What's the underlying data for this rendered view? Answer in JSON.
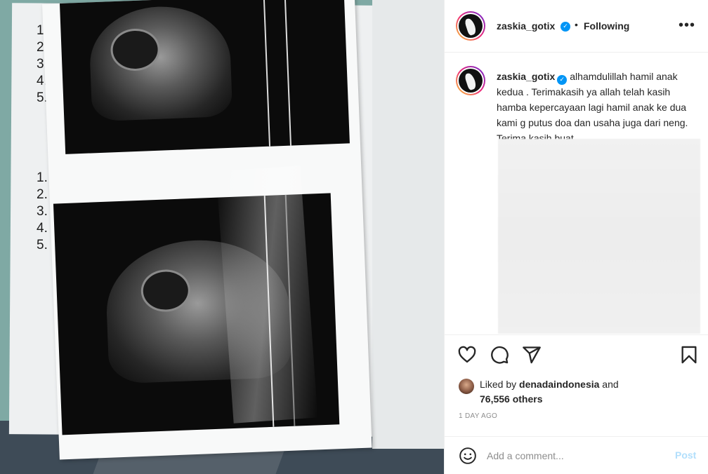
{
  "post": {
    "username": "zaskia_gotix",
    "verified_mark": "✓",
    "separator": "•",
    "follow_status": "Following",
    "more_label": "•••"
  },
  "caption": {
    "username": "zaskia_gotix",
    "text": "alhamdulillah hamil anak kedua . Terimakasih ya allah telah kasih hamba kepercayaan lagi hamil anak ke dua kami g putus doa dan usaha juga dari neng. Terima kasih buat"
  },
  "likes": {
    "prefix": "Liked by",
    "liker": "denadaindonesia",
    "conjunction": "and",
    "others": "76,556 others"
  },
  "timestamp": "1 day ago",
  "comment_box": {
    "placeholder": "Add a comment...",
    "post_label": "Post"
  },
  "photo": {
    "list_top": [
      "1.",
      "2.",
      "3.",
      "4.",
      "5."
    ],
    "list_bottom": [
      "1.",
      "2.",
      "3.",
      "4.",
      "5."
    ]
  },
  "colors": {
    "accent": "#0095f6",
    "post_disabled": "#b2dffc",
    "muted": "#8e8e8e"
  },
  "icons": {
    "like": "heart-icon",
    "comment": "comment-icon",
    "share": "share-icon",
    "save": "bookmark-icon",
    "emoji": "emoji-icon",
    "more": "more-icon"
  }
}
